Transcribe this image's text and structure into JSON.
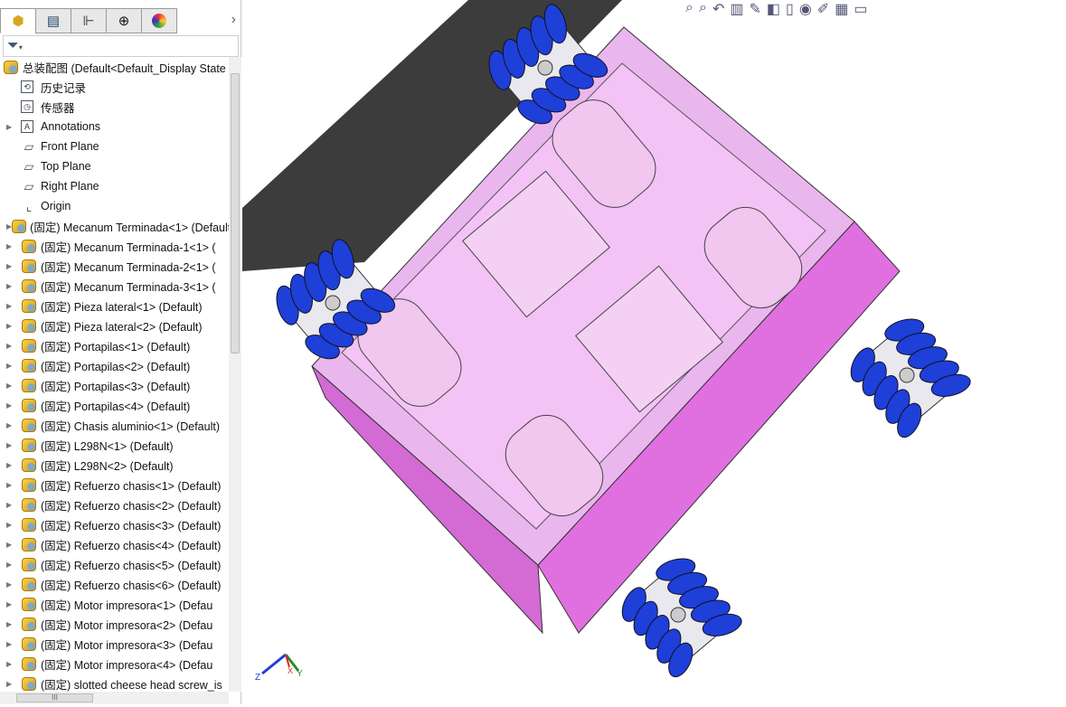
{
  "panel": {
    "tabs": [
      {
        "name": "featuremanager",
        "icon": "assembly-icon"
      },
      {
        "name": "propertymanager",
        "icon": "property-list-icon"
      },
      {
        "name": "configurationmanager",
        "icon": "configuration-icon"
      },
      {
        "name": "dimxpert",
        "icon": "crosshair-icon"
      },
      {
        "name": "display-manager",
        "icon": "appearance-ball-icon"
      }
    ],
    "tabs_more": "›",
    "filter_icon": "funnel-icon",
    "root": "总装配图  (Default<Default_Display State",
    "items": [
      {
        "label": "历史记录",
        "icon": "history-folder-icon",
        "expand": false
      },
      {
        "label": "传感器",
        "icon": "sensor-folder-icon",
        "expand": false
      },
      {
        "label": "Annotations",
        "icon": "annotations-folder-icon",
        "expand": true
      },
      {
        "label": "Front Plane",
        "icon": "plane-icon",
        "expand": false
      },
      {
        "label": "Top Plane",
        "icon": "plane-icon",
        "expand": false
      },
      {
        "label": "Right Plane",
        "icon": "plane-icon",
        "expand": false
      },
      {
        "label": "Origin",
        "icon": "origin-icon",
        "expand": false
      },
      {
        "label": "(固定) Mecanum Terminada<1> (Default",
        "icon": "subassembly-icon",
        "expand": true
      },
      {
        "label": "(固定) Mecanum Terminada-1<1> (",
        "icon": "subassembly-icon",
        "expand": true
      },
      {
        "label": "(固定) Mecanum Terminada-2<1> (",
        "icon": "subassembly-icon",
        "expand": true
      },
      {
        "label": "(固定) Mecanum Terminada-3<1> (",
        "icon": "subassembly-icon",
        "expand": true
      },
      {
        "label": "(固定) Pieza lateral<1> (Default)",
        "icon": "part-icon",
        "expand": true
      },
      {
        "label": "(固定) Pieza lateral<2> (Default)",
        "icon": "part-icon",
        "expand": true
      },
      {
        "label": "(固定) Portapilas<1> (Default)",
        "icon": "part-icon",
        "expand": true
      },
      {
        "label": "(固定) Portapilas<2> (Default)",
        "icon": "part-icon",
        "expand": true
      },
      {
        "label": "(固定) Portapilas<3> (Default)",
        "icon": "part-icon",
        "expand": true
      },
      {
        "label": "(固定) Portapilas<4> (Default)",
        "icon": "part-icon",
        "expand": true
      },
      {
        "label": "(固定) Chasis aluminio<1> (Default)",
        "icon": "part-icon",
        "expand": true
      },
      {
        "label": "(固定) L298N<1> (Default)",
        "icon": "part-icon",
        "expand": true
      },
      {
        "label": "(固定) L298N<2> (Default)",
        "icon": "part-icon",
        "expand": true
      },
      {
        "label": "(固定) Refuerzo chasis<1> (Default)",
        "icon": "part-icon",
        "expand": true
      },
      {
        "label": "(固定) Refuerzo chasis<2> (Default)",
        "icon": "part-icon",
        "expand": true
      },
      {
        "label": "(固定) Refuerzo chasis<3> (Default)",
        "icon": "part-icon",
        "expand": true
      },
      {
        "label": "(固定) Refuerzo chasis<4> (Default)",
        "icon": "part-icon",
        "expand": true
      },
      {
        "label": "(固定) Refuerzo chasis<5> (Default)",
        "icon": "part-icon",
        "expand": true
      },
      {
        "label": "(固定) Refuerzo chasis<6> (Default)",
        "icon": "part-icon",
        "expand": true
      },
      {
        "label": "(固定) Motor impresora<1> (Defau",
        "icon": "part-icon",
        "expand": true
      },
      {
        "label": "(固定) Motor impresora<2> (Defau",
        "icon": "part-icon",
        "expand": true
      },
      {
        "label": "(固定) Motor impresora<3> (Defau",
        "icon": "part-icon",
        "expand": true
      },
      {
        "label": "(固定) Motor impresora<4> (Defau",
        "icon": "part-icon",
        "expand": true
      },
      {
        "label": "(固定) slotted cheese head screw_is",
        "icon": "part-icon",
        "expand": true
      }
    ],
    "hscroll_grip": "III"
  },
  "toolbar": [
    "zoom-to-fit-icon",
    "zoom-area-icon",
    "previous-view-icon",
    "section-view-icon",
    "dynamic-annotation-icon",
    "view-orientation-icon",
    "display-style-icon",
    "hide-show-icon",
    "edit-appearance-icon",
    "apply-scene-icon",
    "view-settings-icon"
  ],
  "triad": {
    "x": "X",
    "y": "Y",
    "z": "Z"
  },
  "colors": {
    "chassis": "#f08ef0",
    "wheel": "#1e3fd8",
    "shadow": "#3c3c3c"
  }
}
